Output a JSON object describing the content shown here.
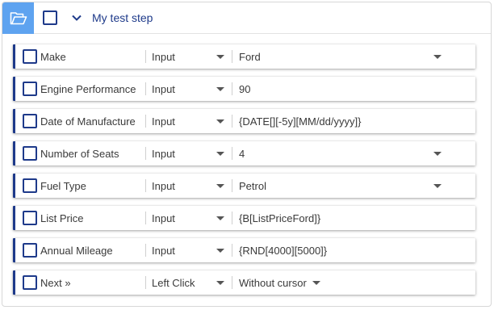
{
  "header": {
    "title": "My test step",
    "folder_icon": "folder-open-icon",
    "accent_color": "#5ea3f0"
  },
  "rows": [
    {
      "name": "Make",
      "action": "Input",
      "value": "Ford",
      "value_dropdown": true
    },
    {
      "name": "Engine Performance",
      "action": "Input",
      "value": "90",
      "value_dropdown": false
    },
    {
      "name": "Date of Manufacture",
      "action": "Input",
      "value": "{DATE[][-5y][MM/dd/yyyy]}",
      "value_dropdown": false
    },
    {
      "name": "Number of Seats",
      "action": "Input",
      "value": "4",
      "value_dropdown": true
    },
    {
      "name": "Fuel Type",
      "action": "Input",
      "value": "Petrol",
      "value_dropdown": true
    },
    {
      "name": "List Price",
      "action": "Input",
      "value": "{B[ListPriceFord]}",
      "value_dropdown": false
    },
    {
      "name": "Annual Mileage",
      "action": "Input",
      "value": "{RND[4000][5000]}",
      "value_dropdown": false
    },
    {
      "name": "Next »",
      "action": "Left Click",
      "value": "Without cursor",
      "value_dropdown": true
    }
  ],
  "colors": {
    "primary": "#1e3a8a",
    "row_border": "#1e3a8a"
  }
}
